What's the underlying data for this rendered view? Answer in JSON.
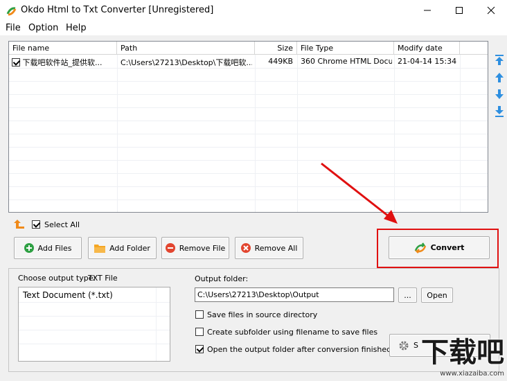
{
  "window": {
    "title": "Okdo Html to Txt Converter [Unregistered]"
  },
  "menu": {
    "items": [
      "File",
      "Option",
      "Help"
    ]
  },
  "file_list": {
    "columns": [
      "File name",
      "Path",
      "Size",
      "File Type",
      "Modify date"
    ],
    "rows": [
      {
        "checked": true,
        "file_name": "下载吧软件站_提供软...",
        "path": "C:\\Users\\27213\\Desktop\\下载吧软...",
        "size": "449KB",
        "file_type": "360 Chrome HTML Docu...",
        "modify_date": "21-04-14 15:34"
      }
    ]
  },
  "select_all": {
    "label": "Select All",
    "checked": true
  },
  "buttons": {
    "add_files": "Add Files",
    "add_folder": "Add Folder",
    "remove_file": "Remove File",
    "remove_all": "Remove All",
    "convert": "Convert",
    "browse": "...",
    "open": "Open",
    "settings": "S"
  },
  "output": {
    "type_label": "Choose output type:",
    "type_value": "TXT File",
    "type_options": [
      "Text Document (*.txt)"
    ],
    "folder_label": "Output folder:",
    "folder_value": "C:\\Users\\27213\\Desktop\\Output",
    "options": [
      {
        "label": "Save files in source directory",
        "checked": false
      },
      {
        "label": "Create subfolder using filename to save files",
        "checked": false
      },
      {
        "label": "Open the output folder after conversion finished",
        "checked": true
      }
    ]
  },
  "watermark": {
    "brand": "下载吧",
    "url": "www.xiazaiba.com"
  },
  "colors": {
    "annotation_red": "#e01010",
    "arrow_blue": "#2e8fe0",
    "add_green": "#2ea043",
    "remove_red": "#e2452f"
  }
}
